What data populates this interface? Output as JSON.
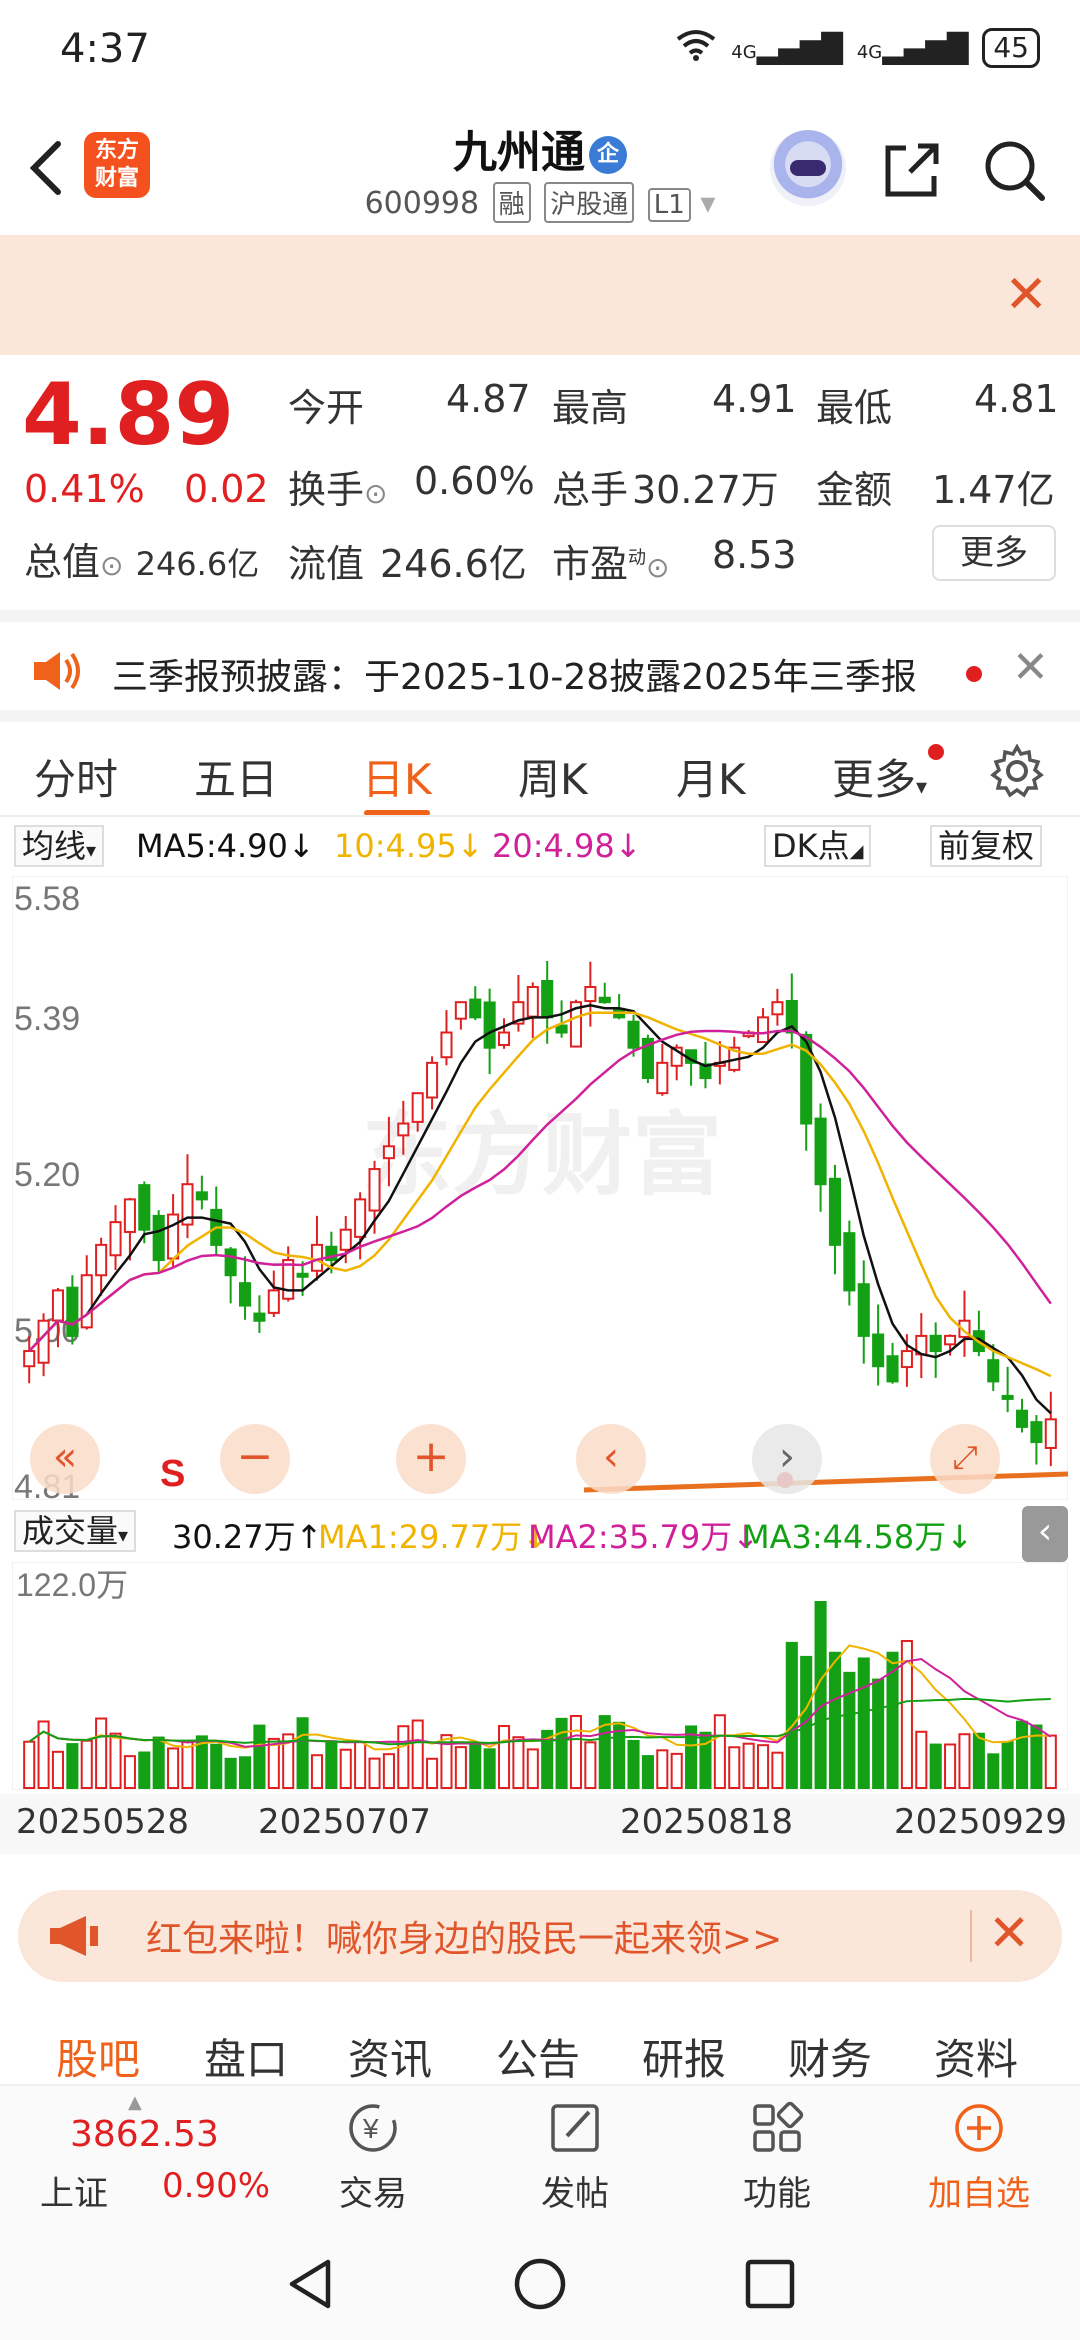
{
  "status_bar": {
    "time": "4:37",
    "network_1": "4G",
    "network_2": "4G",
    "battery": "45"
  },
  "header": {
    "stock_name": "九州通",
    "qi_badge": "企",
    "code": "600998",
    "tags": [
      "融",
      "沪股通",
      "L1"
    ],
    "logo_line1": "东方",
    "logo_line2": "财富"
  },
  "banner": {
    "close_label": "✕"
  },
  "quote": {
    "price": "4.89",
    "change_pct": "0.41%",
    "change": "0.02",
    "total_value_label": "总值",
    "total_value": "246.6亿",
    "open_label": "今开",
    "open": "4.87",
    "high_label": "最高",
    "high": "4.91",
    "low_label": "最低",
    "low": "4.81",
    "turnover_label": "换手",
    "turnover": "0.60%",
    "volume_label": "总手",
    "volume": "30.27万",
    "amount_label": "金额",
    "amount": "1.47亿",
    "float_value_label": "流值",
    "float_value": "246.6亿",
    "pe_label": "市盈",
    "pe_sup": "动",
    "pe": "8.53",
    "more_label": "更多"
  },
  "notice": {
    "text": "三季报预披露：于2025-10-28披露2025年三季报"
  },
  "tabs": [
    "分时",
    "五日",
    "日K",
    "周K",
    "月K",
    "更多"
  ],
  "active_tab": "日K",
  "chart_header": {
    "ma_selector": "均线",
    "ma5": "MA5:4.90↓",
    "ma10": "10:4.95↓",
    "ma20": "20:4.98↓",
    "dk_label": "DK点",
    "fq_label": "前复权"
  },
  "kline": {
    "y_labels": [
      "5.58",
      "5.39",
      "5.20",
      "5.00",
      "4.81"
    ],
    "s_marker": "S",
    "watermark": "东方财富"
  },
  "volume_header": {
    "selector": "成交量",
    "vol": "30.27万↑",
    "ma1": "MA1:29.77万↓",
    "ma2": "MA2:35.79万↓",
    "ma3": "MA3:44.58万↓",
    "max_label": "122.0万"
  },
  "x_dates": [
    "20250528",
    "20250707",
    "20250818",
    "20250929"
  ],
  "colors": {
    "up": "#e02020",
    "down": "#14a014",
    "ma5": "#111111",
    "ma10": "#f0b400",
    "ma20": "#d0209a",
    "accent": "#f0611a"
  },
  "chart_data": {
    "type": "candlestick",
    "y_range": [
      4.81,
      5.58
    ],
    "volume_max": "122.0万",
    "x_ticks": [
      "20250528",
      "20250707",
      "20250818",
      "20250929"
    ],
    "series": [
      {
        "name": "MA5",
        "last": 4.9
      },
      {
        "name": "10",
        "last": 4.95
      },
      {
        "name": "20",
        "last": 4.98
      }
    ],
    "volume_series": [
      {
        "name": "MA1",
        "last": "29.77万"
      },
      {
        "name": "MA2",
        "last": "35.79万"
      },
      {
        "name": "MA3",
        "last": "44.58万"
      }
    ],
    "closes": [
      4.98,
      5.02,
      5.06,
      5.0,
      5.08,
      5.12,
      5.15,
      5.18,
      5.14,
      5.1,
      5.16,
      5.2,
      5.18,
      5.12,
      5.08,
      5.04,
      5.02,
      5.06,
      5.1,
      5.08,
      5.12,
      5.1,
      5.14,
      5.18,
      5.22,
      5.25,
      5.28,
      5.32,
      5.36,
      5.4,
      5.44,
      5.42,
      5.38,
      5.4,
      5.44,
      5.46,
      5.42,
      5.4,
      5.44,
      5.46,
      5.44,
      5.42,
      5.38,
      5.34,
      5.36,
      5.38,
      5.36,
      5.34,
      5.36,
      5.38,
      5.4,
      5.42,
      5.44,
      5.4,
      5.28,
      5.2,
      5.12,
      5.06,
      5.0,
      4.96,
      4.94,
      4.98,
      5.0,
      4.98,
      5.0,
      5.02,
      4.98,
      4.94,
      4.92,
      4.88,
      4.86,
      4.89
    ]
  },
  "promo": {
    "text": "红包来啦！喊你身边的股民一起来领>>"
  },
  "bottom_tabs": [
    "股吧",
    "盘口",
    "资讯",
    "公告",
    "研报",
    "财务",
    "资料"
  ],
  "active_bottom_tab": "股吧",
  "index": {
    "value": "3862.53",
    "name": "上证",
    "change_pct": "0.90%"
  },
  "bottom_bar": {
    "trade": "交易",
    "post": "发帖",
    "features": "功能",
    "add": "加自选"
  }
}
